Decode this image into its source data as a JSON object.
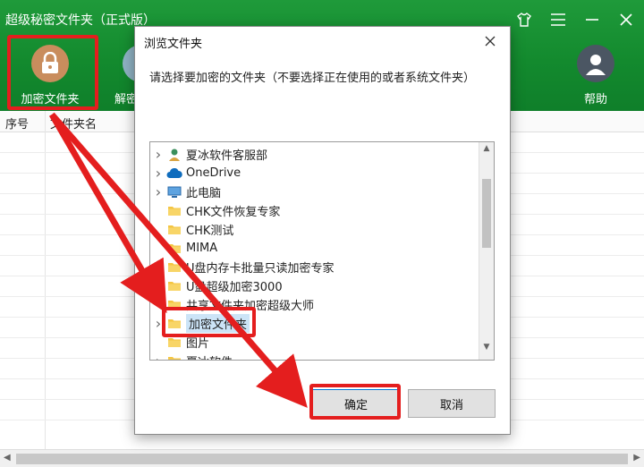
{
  "app": {
    "title": "超级秘密文件夹（正式版）",
    "toolbar": {
      "encrypt_label": "加密文件夹",
      "decrypt_label": "解密",
      "help_label": "帮助"
    },
    "columns": [
      "序号",
      "文件夹名"
    ],
    "colors": {
      "header_green": "#138a2e",
      "highlight_red": "#e41e1e"
    }
  },
  "dialog": {
    "title": "浏览文件夹",
    "instruction": "请选择要加密的文件夹（不要选择正在使用的或者系统文件夹）",
    "tree": [
      {
        "label": "夏冰软件客服部",
        "icon": "user-icon",
        "expandable": true
      },
      {
        "label": "OneDrive",
        "icon": "cloud-icon",
        "expandable": true
      },
      {
        "label": "此电脑",
        "icon": "computer-icon",
        "expandable": true
      },
      {
        "label": "CHK文件恢复专家",
        "icon": "folder-icon",
        "expandable": false
      },
      {
        "label": "CHK测试",
        "icon": "folder-icon",
        "expandable": false
      },
      {
        "label": "MIMA",
        "icon": "folder-icon",
        "expandable": false
      },
      {
        "label": "U盘内存卡批量只读加密专家",
        "icon": "folder-icon",
        "expandable": false
      },
      {
        "label": "U盘超级加密3000",
        "icon": "folder-icon",
        "expandable": false
      },
      {
        "label": "共享文件夹加密超级大师",
        "icon": "folder-icon",
        "expandable": false
      },
      {
        "label": "加密文件夹",
        "icon": "folder-icon",
        "expandable": true,
        "selected": true
      },
      {
        "label": "图片",
        "icon": "folder-icon",
        "expandable": false
      },
      {
        "label": "夏冰软件",
        "icon": "folder-icon",
        "expandable": true
      }
    ],
    "ok_label": "确定",
    "cancel_label": "取消"
  }
}
